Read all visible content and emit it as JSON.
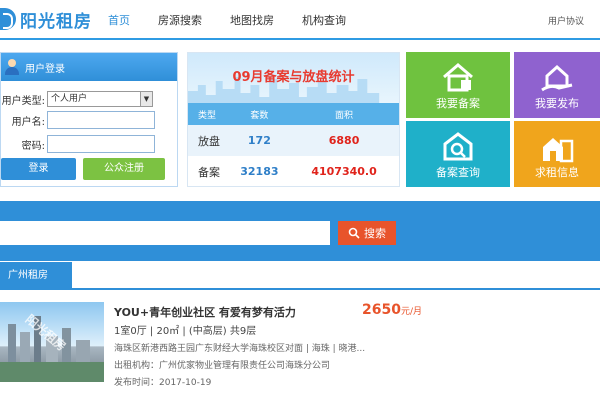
{
  "header": {
    "logo": "阳光租房",
    "nav": [
      "首页",
      "房源搜索",
      "地图找房",
      "机构查询"
    ],
    "user_agreement": "用户协议"
  },
  "login": {
    "title": "用户登录",
    "user_type_label": "用户类型:",
    "user_type_value": "个人用户",
    "account_label": "用户名:",
    "password_label": "密码:",
    "login_button": "登录",
    "register_button": "公众注册"
  },
  "stats": {
    "title": "09月备案与放盘统计",
    "headers": [
      "类型",
      "套数",
      "面积"
    ],
    "rows": [
      {
        "type": "放盘",
        "count": "172",
        "area": "6880"
      },
      {
        "type": "备案",
        "count": "32183",
        "area": "4107340.0"
      }
    ]
  },
  "tiles": [
    {
      "label": "我要备案",
      "color": "#6fc23f"
    },
    {
      "label": "我要发布",
      "color": "#8f62cf"
    },
    {
      "label": "备案查询",
      "color": "#1fb0c9"
    },
    {
      "label": "求租信息",
      "color": "#f0a51c"
    }
  ],
  "search": {
    "placeholder": "",
    "button": "搜索"
  },
  "section": {
    "tab": "广州租房"
  },
  "listing": {
    "title": "YOU+青年创业社区 有爱有梦有活力",
    "price": "2650",
    "price_unit": "元/月",
    "layout": "1室0厅 | 20㎡ | (中高层) 共9层",
    "address": "海珠区新港西路王园广东财经大学海珠校区对面 | 海珠 | 晓港...",
    "agency": "出租机构：广州优家物业管理有限责任公司海珠分公司",
    "date": "发布时间：2017-10-19",
    "watermark": "阳光租房"
  }
}
